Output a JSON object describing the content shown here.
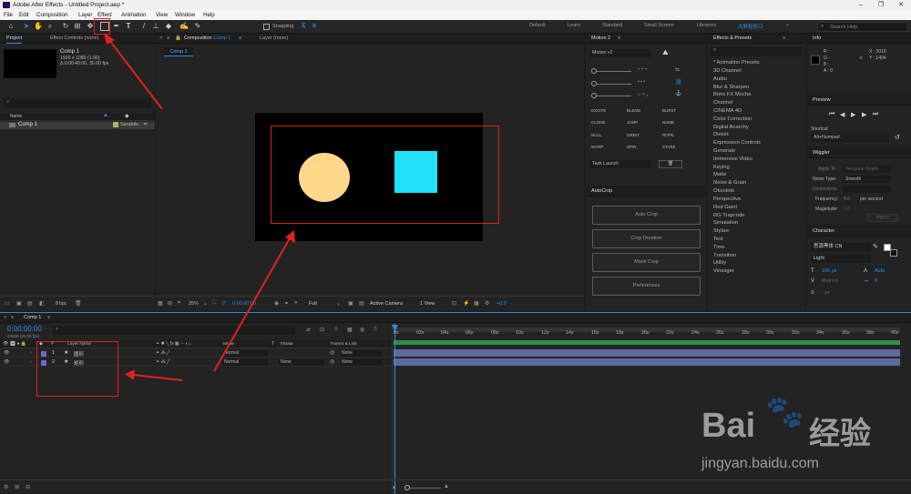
{
  "window": {
    "title": "Adobe After Effects - Untitled Project.aep *",
    "controls": {
      "minimize": "–",
      "maximize": "❐",
      "close": "✕"
    }
  },
  "menu": [
    "File",
    "Edit",
    "Composition",
    "Layer",
    "Effect",
    "Animation",
    "View",
    "Window",
    "Help"
  ],
  "toolbar": {
    "snapping_label": "Snapping",
    "workspaces": [
      "Default",
      "Learn",
      "Standard",
      "Small Screen",
      "Libraries"
    ],
    "active_workspace": "大屏投影口",
    "search_placeholder": "Search Help"
  },
  "project": {
    "tab": "Project",
    "tab2": "Effect Controls (none)",
    "comp_name": "Comp 1",
    "comp_info1": "1920 x 1080 (1.00)",
    "comp_info2": "Δ 0:00:40:00, 30.00 fps",
    "col_name": "Name",
    "item_name": "Comp 1",
    "item_type": "Sandolo",
    "bpc": "8 bpc"
  },
  "composition": {
    "tab": "Composition",
    "tab_comp": "Comp 1",
    "tab_layer": "Layer (none)",
    "subtab": "Comp 1",
    "zoom": "25%",
    "timecode": "0:00:00:00",
    "quality": "Full",
    "camera": "Active Camera",
    "view": "1 View",
    "exposure": "+0.0"
  },
  "motion": {
    "title": "Motion 2",
    "version": "Motion v2",
    "grid": [
      "EXCITE",
      "BLEND",
      "BURST",
      "CLONE",
      "JUMP",
      "NAME",
      "NULL",
      "ORBIT",
      "ROPE",
      "WARP",
      "SPIN",
      "STARE"
    ],
    "dropdown": "Task Launch"
  },
  "autocrop": {
    "title": "AutoCrop",
    "buttons": [
      "Auto Crop",
      "Crop Duration",
      "Mask Crop",
      "Preferences"
    ]
  },
  "effects": {
    "title": "Effects & Presets",
    "items": [
      "* Animation Presets",
      "3D Channel",
      "Audio",
      "Blur & Sharpen",
      "Boris FX Mocha",
      "Channel",
      "CINEMA 4D",
      "Color Correction",
      "Digital Anarchy",
      "Distort",
      "Expression Controls",
      "Generate",
      "Immersive Video",
      "Keying",
      "Matte",
      "Noise & Grain",
      "Obsolete",
      "Perspective",
      "Red Giant",
      "RG Trapcode",
      "Simulation",
      "Stylize",
      "Text",
      "Time",
      "Transition",
      "Utility",
      "Vinsager"
    ]
  },
  "info": {
    "title": "Info",
    "r": "R :",
    "g": "G :",
    "b": "B :",
    "a": "A : 0",
    "x": "X : 2016",
    "y": "Y : 1404"
  },
  "preview": {
    "title": "Preview",
    "shortcut_label": "Shortcut",
    "shortcut_value": "Alt+Numpad ."
  },
  "wiggler": {
    "title": "Wiggler",
    "apply_to_label": "Apply To:",
    "apply_to_value": "Temporal Graph",
    "noise_label": "Noise Type:",
    "noise_value": "Smooth",
    "dimensions_label": "Dimensions:",
    "frequency_label": "Frequency:",
    "frequency_value": "5.0",
    "frequency_unit": "per second",
    "magnitude_label": "Magnitude:",
    "magnitude_value": "1.0",
    "apply_button": "Apply"
  },
  "character": {
    "title": "Character",
    "font": "思源黑体 CN",
    "style": "Light",
    "size": "106 px",
    "tracking": "Auto",
    "kerning": "Metrics",
    "stroke": "0",
    "unit": "- px"
  },
  "timeline": {
    "tab": "Comp 1",
    "timecode": "0:00:00:00",
    "frames": "00000 (30.00 fps)",
    "col_layer_name": "Layer Name",
    "col_mode": "Mode",
    "col_trkmat": "TrkMat",
    "col_parent": "Parent & Link",
    "layers": [
      {
        "num": "1",
        "name": "圆形",
        "mode": "Normal",
        "trkmat": "",
        "parent": "None"
      },
      {
        "num": "2",
        "name": "矩形",
        "mode": "Normal",
        "trkmat": "None",
        "parent": "None"
      }
    ],
    "ticks": [
      "0s",
      "02s",
      "04s",
      "06s",
      "08s",
      "10s",
      "12s",
      "14s",
      "16s",
      "18s",
      "20s",
      "22s",
      "24s",
      "26s",
      "28s",
      "30s",
      "32s",
      "34s",
      "36s",
      "38s",
      "40s"
    ]
  },
  "watermark": {
    "brand": "Bai",
    "brand2": "经验",
    "url": "jingyan.baidu.com"
  },
  "colors": {
    "accent": "#2d8ceb",
    "circle": "#ffd98a",
    "square": "#22e0f5",
    "annotation": "#e02020",
    "layer_label": "#6a6ad0",
    "track": "#5b6a9c",
    "work_area": "#2f8f48"
  }
}
